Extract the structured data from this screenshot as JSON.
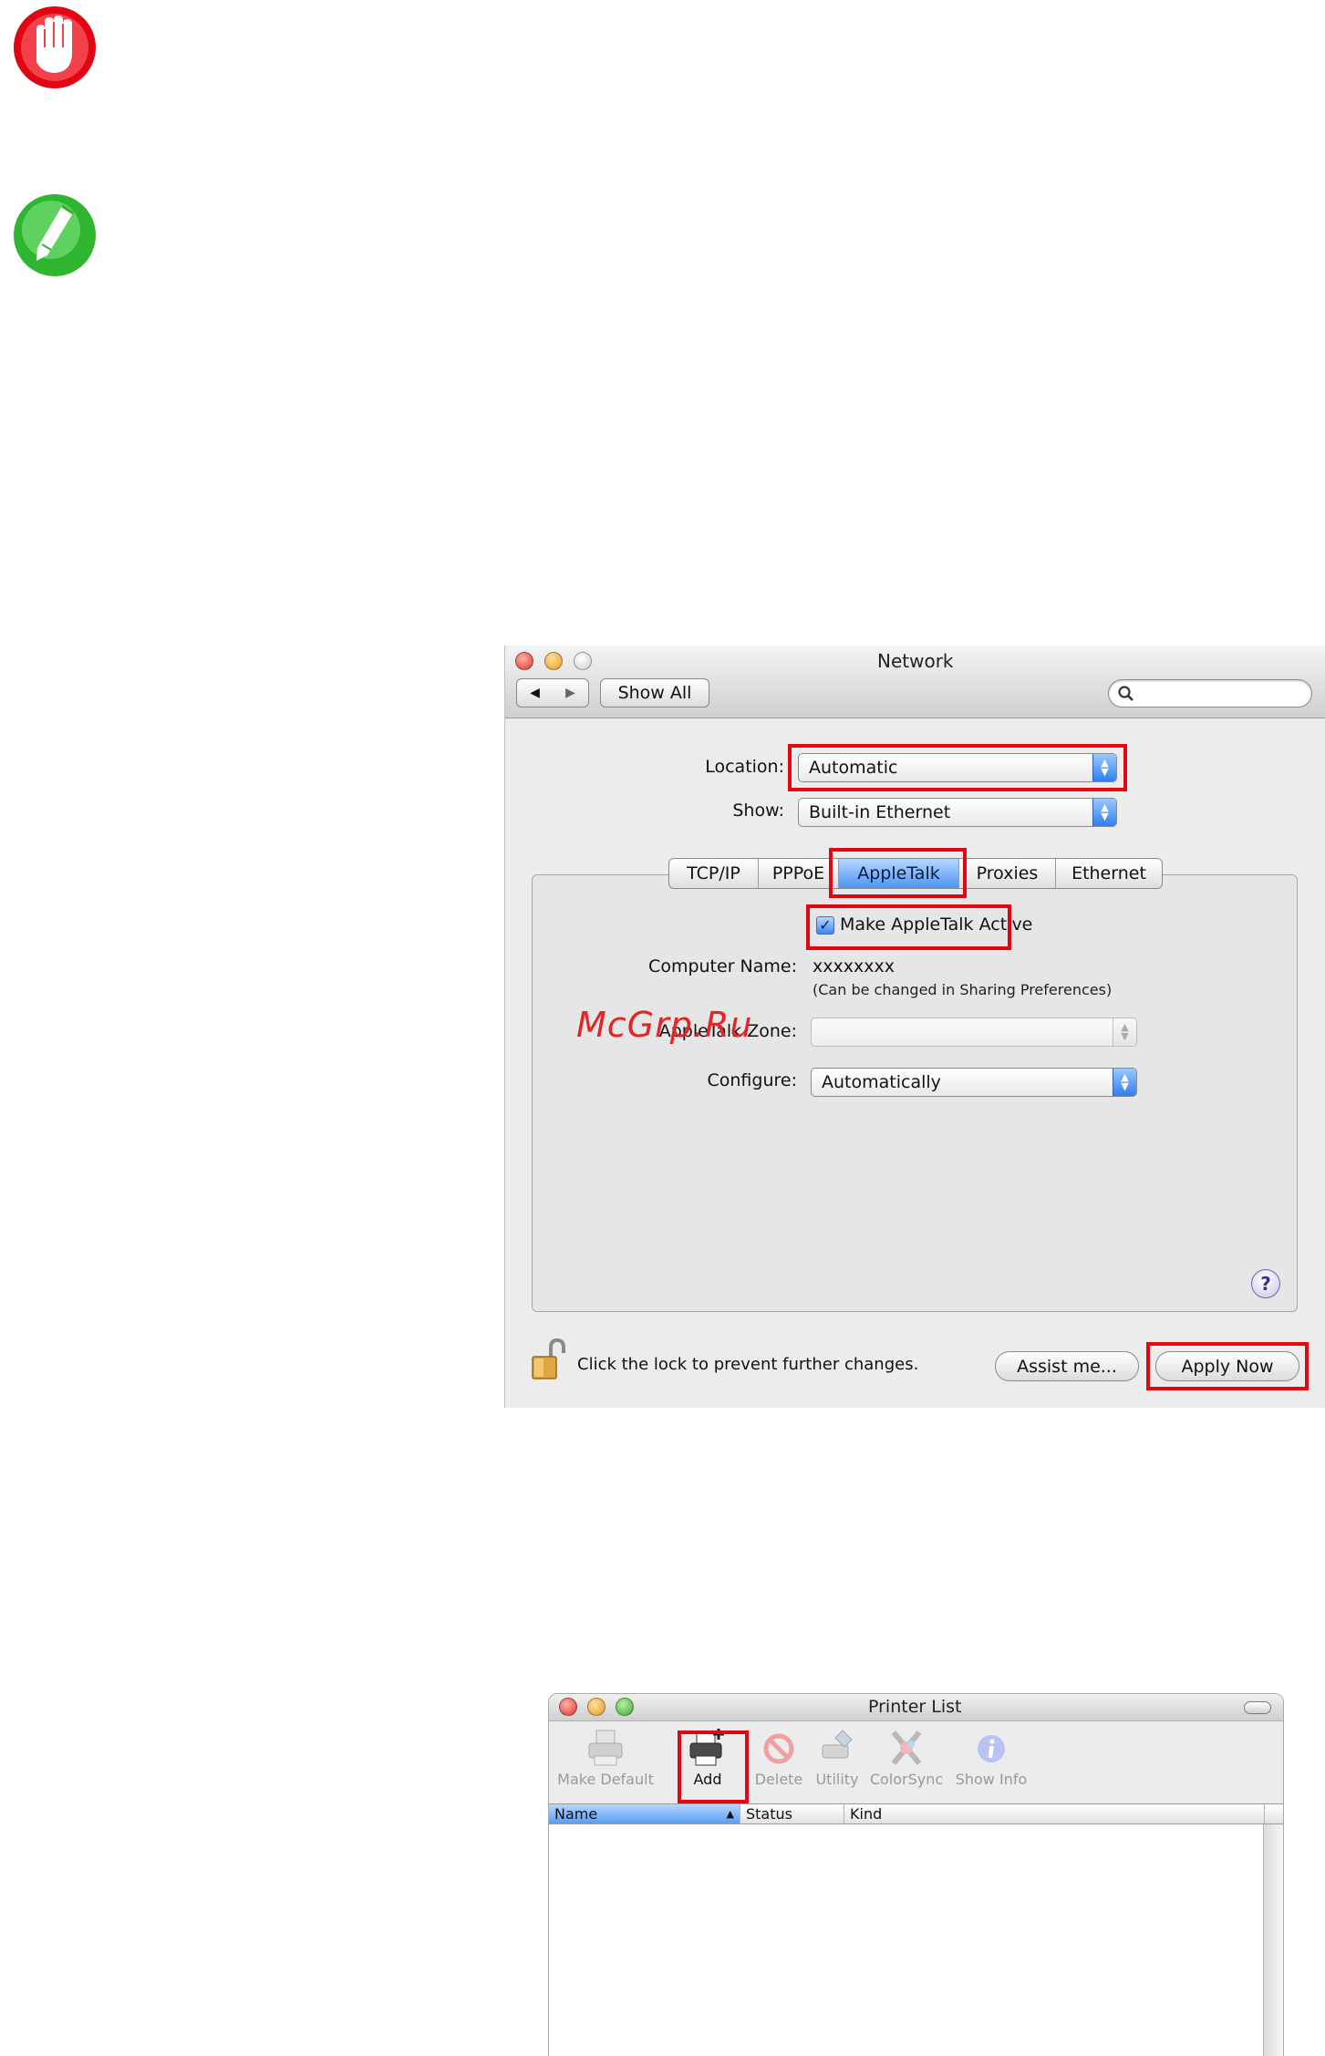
{
  "notices": {
    "caution_icon": "hand-stop-icon",
    "note_icon": "pencil-icon",
    "caution_color": "#e20613",
    "note_color": "#2fb52f"
  },
  "network": {
    "title": "Network",
    "show_all_label": "Show All",
    "search_placeholder": "",
    "location_label": "Location:",
    "location_value": "Automatic",
    "show_label": "Show:",
    "show_value": "Built-in Ethernet",
    "tabs": [
      {
        "label": "TCP/IP",
        "selected": false
      },
      {
        "label": "PPPoE",
        "selected": false
      },
      {
        "label": "AppleTalk",
        "selected": true
      },
      {
        "label": "Proxies",
        "selected": false
      },
      {
        "label": "Ethernet",
        "selected": false
      }
    ],
    "make_active_label": "Make AppleTalk Active",
    "make_active_checked": true,
    "computer_name_label": "Computer Name:",
    "computer_name_value": "xxxxxxxx",
    "computer_name_note": "(Can be changed in Sharing Preferences)",
    "zone_label": "AppleTalk Zone:",
    "zone_value": "",
    "configure_label": "Configure:",
    "configure_value": "Automatically",
    "lock_text": "Click the lock to prevent further changes.",
    "assist_label": "Assist me...",
    "apply_label": "Apply Now",
    "highlight_color": "#e20613"
  },
  "watermark": "McGrp.Ru",
  "printer_list": {
    "title": "Printer List",
    "tools": [
      {
        "label": "Make Default",
        "icon": "printer-default-icon",
        "enabled": false
      },
      {
        "label": "Add",
        "icon": "add-printer-icon",
        "enabled": true
      },
      {
        "label": "Delete",
        "icon": "delete-icon",
        "enabled": false
      },
      {
        "label": "Utility",
        "icon": "utility-icon",
        "enabled": false
      },
      {
        "label": "ColorSync",
        "icon": "colorsync-icon",
        "enabled": false
      },
      {
        "label": "Show Info",
        "icon": "info-icon",
        "enabled": false
      }
    ],
    "columns": [
      "Name",
      "Status",
      "Kind"
    ]
  }
}
